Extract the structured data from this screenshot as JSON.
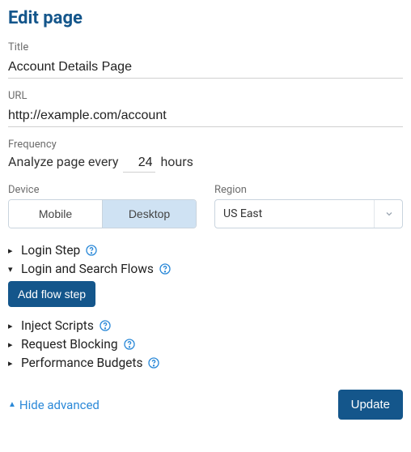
{
  "header": {
    "title": "Edit page"
  },
  "fields": {
    "title": {
      "label": "Title",
      "value": "Account Details Page"
    },
    "url": {
      "label": "URL",
      "value": "http://example.com/account"
    },
    "frequency": {
      "label": "Frequency",
      "prefix": "Analyze page every",
      "value": "24",
      "suffix": "hours"
    },
    "device": {
      "label": "Device",
      "options": {
        "mobile": "Mobile",
        "desktop": "Desktop"
      },
      "selected": "desktop"
    },
    "region": {
      "label": "Region",
      "value": "US East"
    }
  },
  "sections": {
    "login_step": {
      "label": "Login Step",
      "expanded": false
    },
    "flows": {
      "label": "Login and Search Flows",
      "expanded": true,
      "add_button": "Add flow step"
    },
    "inject_scripts": {
      "label": "Inject Scripts",
      "expanded": false
    },
    "request_blocking": {
      "label": "Request Blocking",
      "expanded": false
    },
    "perf_budgets": {
      "label": "Performance Budgets",
      "expanded": false
    }
  },
  "advanced": {
    "toggle_label": "Hide advanced"
  },
  "actions": {
    "update": "Update"
  }
}
